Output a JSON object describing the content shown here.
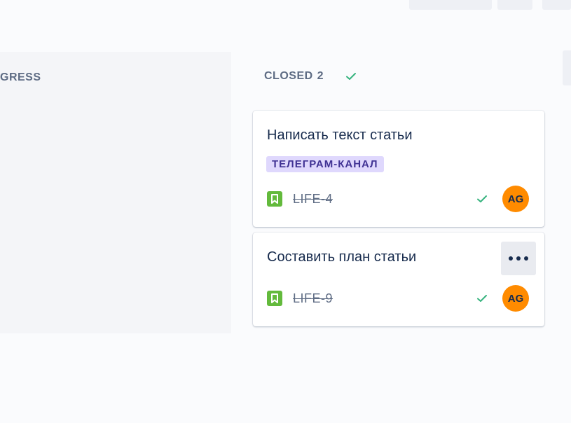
{
  "columns": {
    "in_progress": {
      "title": "GRESS"
    },
    "closed": {
      "title": "CLOSED",
      "count": "2",
      "icon": "check-icon"
    }
  },
  "cards": [
    {
      "title": "Написать текст статьи",
      "label": "ТЕЛЕГРАМ-КАНАЛ",
      "type_icon": "story-icon",
      "key": "LIFE-4",
      "status_icon": "check-icon",
      "assignee_initials": "AG"
    },
    {
      "title": "Составить план статьи",
      "type_icon": "story-icon",
      "key": "LIFE-9",
      "status_icon": "check-icon",
      "assignee_initials": "AG",
      "more_icon": "more-icon"
    }
  ],
  "colors": {
    "story": "#63ba3c",
    "done_check": "#36b37e",
    "avatar": "#ff8b00",
    "label_bg": "#dfd8fd",
    "label_text": "#403294"
  }
}
